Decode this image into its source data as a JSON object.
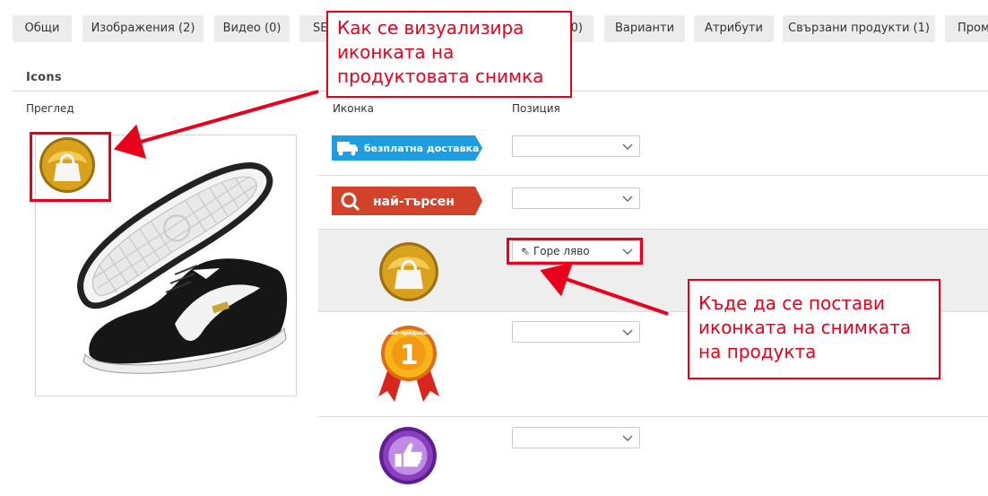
{
  "tabs": [
    {
      "label": "Общи"
    },
    {
      "label": "Изображения (2)"
    },
    {
      "label": "Видео (0)"
    },
    {
      "label": "SEO"
    },
    {
      "label": "(0)"
    },
    {
      "label": "Варианти"
    },
    {
      "label": "Атрибути"
    },
    {
      "label": "Свързани продукти (1)"
    },
    {
      "label": "Пром"
    }
  ],
  "section": {
    "title": "Icons",
    "preview_header": "Преглед",
    "icon_header": "Иконка",
    "position_header": "Позиция"
  },
  "icons": [
    {
      "name": "free-delivery-badge",
      "text": "безплатна доставка",
      "position_value": ""
    },
    {
      "name": "most-searched-badge",
      "text": "най-търсен",
      "position_value": ""
    },
    {
      "name": "shopping-bag-icon",
      "position_value": "⇖ Горе ляво"
    },
    {
      "name": "bestseller-medal-icon",
      "text": "най-продаван",
      "number": "1",
      "position_value": ""
    },
    {
      "name": "thumbs-up-icon",
      "position_value": ""
    }
  ],
  "callouts": {
    "top": "Как се визуализира иконката на продуктовата снимка",
    "bottom": "Къде да се постави иконката на снимката на продукта"
  },
  "colors": {
    "highlight": "#e8001c",
    "tab_bg": "#ececec",
    "selected_row_bg": "#eeeeee",
    "delivery_badge": "#1e9ee0",
    "searched_badge": "#d2412a",
    "bag_gold": "#d6a21a",
    "thumbs_purple": "#8a3fbf"
  }
}
